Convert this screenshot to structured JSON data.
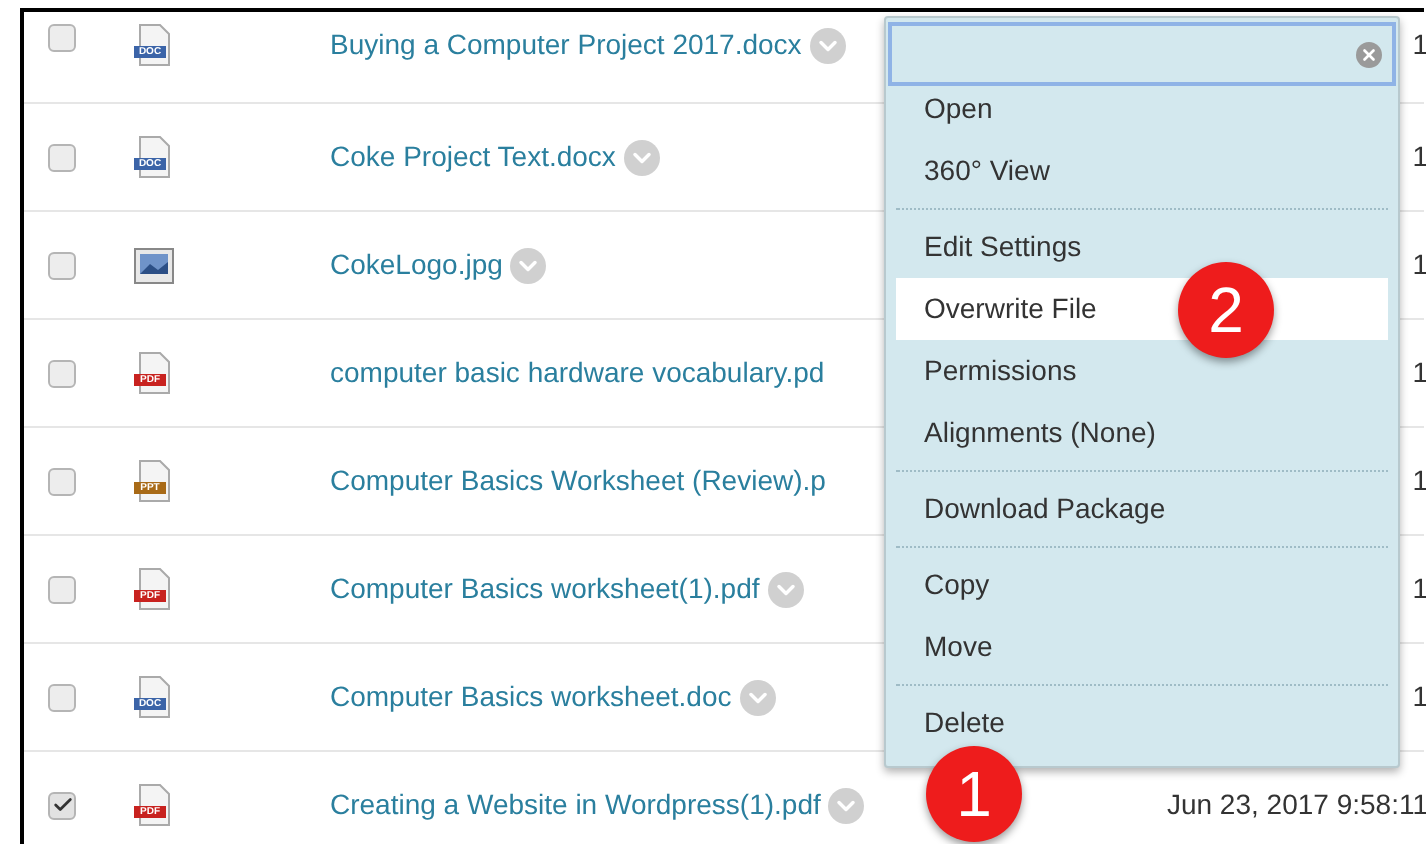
{
  "files": [
    {
      "name": "Buying a Computer Project 2017.docx",
      "kind": "doc",
      "type_label": "DOC",
      "checked": false,
      "chevron": true,
      "date": "1"
    },
    {
      "name": "Coke Project Text.docx",
      "kind": "doc",
      "type_label": "DOC",
      "checked": false,
      "chevron": true,
      "date": "1"
    },
    {
      "name": "CokeLogo.jpg",
      "kind": "image",
      "checked": false,
      "chevron": true,
      "date": "1"
    },
    {
      "name": "computer basic hardware vocabulary.pd",
      "kind": "pdf",
      "type_label": "PDF",
      "checked": false,
      "chevron": false,
      "date": "1"
    },
    {
      "name": "Computer Basics Worksheet (Review).p",
      "kind": "ppt",
      "type_label": "PPT",
      "checked": false,
      "chevron": false,
      "date": "1"
    },
    {
      "name": "Computer Basics worksheet(1).pdf",
      "kind": "pdf",
      "type_label": "PDF",
      "checked": false,
      "chevron": true,
      "date": "1"
    },
    {
      "name": "Computer Basics worksheet.doc",
      "kind": "doc",
      "type_label": "DOC",
      "checked": false,
      "chevron": true,
      "date": "1"
    },
    {
      "name": "Creating a Website in Wordpress(1).pdf",
      "kind": "pdf",
      "type_label": "PDF",
      "checked": true,
      "chevron": true,
      "date": "Jun 23, 2017 9:58:11"
    }
  ],
  "menu": {
    "groups": [
      [
        {
          "label": "Open",
          "selected": false
        },
        {
          "label": "360° View",
          "selected": false
        }
      ],
      [
        {
          "label": "Edit Settings",
          "selected": false
        },
        {
          "label": "Overwrite File",
          "selected": true
        },
        {
          "label": "Permissions",
          "selected": false
        },
        {
          "label": "Alignments (None)",
          "selected": false
        }
      ],
      [
        {
          "label": "Download Package",
          "selected": false
        }
      ],
      [
        {
          "label": "Copy",
          "selected": false
        },
        {
          "label": "Move",
          "selected": false
        }
      ],
      [
        {
          "label": "Delete",
          "selected": false
        }
      ]
    ]
  },
  "badges": [
    {
      "label": "2"
    },
    {
      "label": "1"
    }
  ]
}
